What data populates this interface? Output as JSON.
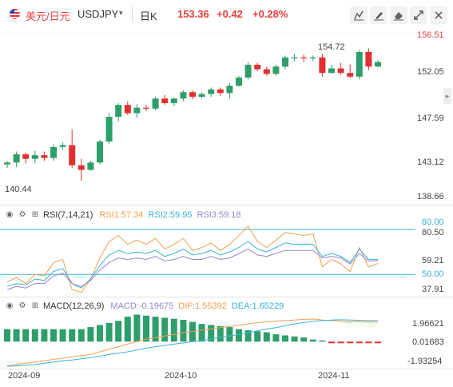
{
  "header": {
    "symbol_cn": "美元/日元",
    "symbol_code": "USDJPY",
    "caret": "▾",
    "period": "日K",
    "price": "153.36",
    "change": "+0.42",
    "change_pct": "+0.28%"
  },
  "toolbar": {
    "icons": [
      "draw-line-icon",
      "brush-icon",
      "erase-icon",
      "fullscreen-icon",
      "close-icon"
    ]
  },
  "main_axis": {
    "ticks": [
      "156.51",
      "152.05",
      "147.59",
      "143.12",
      "138.66"
    ],
    "high_label": "154.72",
    "low_label": "140.44"
  },
  "rsi": {
    "name": "RSI(7,14,21)",
    "rsi1": "RSI1:57.34",
    "rsi2": "RSI2:59.95",
    "rsi3": "RSI3:59.18",
    "ticks": [
      "80.00",
      "80.50",
      "59.21",
      "50.00",
      "37.91"
    ]
  },
  "macd": {
    "name": "MACD(12,26,9)",
    "macd": "MACD:-0.19675",
    "dif": "DIF:1.55392",
    "dea": "DEA:1.65229",
    "ticks": [
      "1.96621",
      "0.01683",
      "-1.93254"
    ]
  },
  "xaxis": [
    "2024-09",
    "2024-10",
    "2024-11"
  ],
  "colors": {
    "up": "#2e9e6b",
    "down": "#e03030",
    "rsi1": "#f0a050",
    "rsi2": "#39b3d6",
    "rsi3": "#9a85c8",
    "dif": "#f0a050",
    "dea": "#39b3d6"
  },
  "chart_data": [
    {
      "type": "candlestick",
      "title": "USDJPY 日K",
      "ylim": [
        138.66,
        156.51
      ],
      "ohlc": [
        [
          142.2,
          142.6,
          141.8,
          142.4
        ],
        [
          142.4,
          143.6,
          141.9,
          143.3
        ],
        [
          143.3,
          143.5,
          142.3,
          142.8
        ],
        [
          142.8,
          143.7,
          142.3,
          143.2
        ],
        [
          143.2,
          143.6,
          142.6,
          142.9
        ],
        [
          142.9,
          144.4,
          142.6,
          144.1
        ],
        [
          144.1,
          144.6,
          143.8,
          144.3
        ],
        [
          144.3,
          146.0,
          141.8,
          142.1
        ],
        [
          142.1,
          142.8,
          140.4,
          141.6
        ],
        [
          141.6,
          142.6,
          141.5,
          142.4
        ],
        [
          142.4,
          144.9,
          142.2,
          144.7
        ],
        [
          144.7,
          147.8,
          144.4,
          147.4
        ],
        [
          147.4,
          148.9,
          146.9,
          148.7
        ],
        [
          148.7,
          149.1,
          147.6,
          147.8
        ],
        [
          147.8,
          148.8,
          147.3,
          148.4
        ],
        [
          148.4,
          148.7,
          148.0,
          148.3
        ],
        [
          148.3,
          149.6,
          148.1,
          149.4
        ],
        [
          149.4,
          149.8,
          148.7,
          148.9
        ],
        [
          148.9,
          149.5,
          148.6,
          149.4
        ],
        [
          149.4,
          150.3,
          149.1,
          150.1
        ],
        [
          150.1,
          150.3,
          149.3,
          149.6
        ],
        [
          149.6,
          150.1,
          149.4,
          149.9
        ],
        [
          149.9,
          150.6,
          149.6,
          150.4
        ],
        [
          150.4,
          150.6,
          149.7,
          150.0
        ],
        [
          150.0,
          151.1,
          149.4,
          150.8
        ],
        [
          150.8,
          151.9,
          150.7,
          151.7
        ],
        [
          151.7,
          153.4,
          151.5,
          153.1
        ],
        [
          153.1,
          153.3,
          152.4,
          152.6
        ],
        [
          152.6,
          152.9,
          151.9,
          152.1
        ],
        [
          152.1,
          153.1,
          151.9,
          152.9
        ],
        [
          152.9,
          154.1,
          152.6,
          153.9
        ],
        [
          153.9,
          154.3,
          153.5,
          153.9
        ],
        [
          153.9,
          154.2,
          153.4,
          153.8
        ],
        [
          153.8,
          154.1,
          153.5,
          153.9
        ],
        [
          153.9,
          154.3,
          151.8,
          152.2
        ],
        [
          152.2,
          153.1,
          152.1,
          152.7
        ],
        [
          152.7,
          153.3,
          152.0,
          152.2
        ],
        [
          152.2,
          153.1,
          151.6,
          151.8
        ],
        [
          151.8,
          154.7,
          151.5,
          154.5
        ],
        [
          154.5,
          154.9,
          152.5,
          152.9
        ],
        [
          152.9,
          153.6,
          152.8,
          153.4
        ]
      ]
    },
    {
      "type": "line",
      "title": "RSI(7,14,21)",
      "ylim": [
        37.91,
        80.5
      ],
      "series": [
        {
          "name": "RSI1",
          "values": [
            45,
            48,
            44,
            50,
            49,
            58,
            60,
            40,
            38,
            47,
            61,
            72,
            76,
            70,
            73,
            70,
            74,
            67,
            70,
            74,
            66,
            68,
            71,
            66,
            70,
            76,
            82,
            72,
            68,
            73,
            78,
            77,
            76,
            77,
            55,
            60,
            57,
            52,
            68,
            55,
            57.34
          ]
        },
        {
          "name": "RSI2",
          "values": [
            42,
            44,
            43,
            47,
            46,
            52,
            54,
            44,
            41,
            47,
            56,
            63,
            66,
            64,
            65,
            64,
            66,
            62,
            64,
            67,
            63,
            64,
            66,
            63,
            65,
            68,
            72,
            67,
            65,
            68,
            71,
            70,
            70,
            70,
            62,
            64,
            62,
            58,
            67,
            60,
            59.95
          ]
        },
        {
          "name": "RSI3",
          "values": [
            40,
            42,
            41,
            44,
            44,
            49,
            51,
            44,
            42,
            46,
            53,
            58,
            61,
            60,
            61,
            60,
            62,
            59,
            60,
            62,
            60,
            60,
            62,
            60,
            61,
            64,
            67,
            63,
            62,
            64,
            66,
            66,
            66,
            66,
            61,
            62,
            61,
            57,
            64,
            59,
            59.18
          ]
        }
      ]
    },
    {
      "type": "bar",
      "title": "MACD(12,26,9)",
      "ylim": [
        -1.93254,
        1.96621
      ],
      "values": [
        0.6,
        0.6,
        0.6,
        0.6,
        0.6,
        0.6,
        0.6,
        0.6,
        0.6,
        0.7,
        0.8,
        0.9,
        1.0,
        1.2,
        1.3,
        1.25,
        1.2,
        1.15,
        1.1,
        1.05,
        0.95,
        0.85,
        0.8,
        0.75,
        0.7,
        0.6,
        0.55,
        0.5,
        0.45,
        0.35,
        0.3,
        0.25,
        0.2,
        0.1,
        0.05,
        -0.05,
        -0.1,
        -0.15,
        -0.1,
        -0.15,
        -0.19675
      ],
      "series": [
        {
          "name": "DIF",
          "values": [
            -1.9,
            -1.8,
            -1.7,
            -1.6,
            -1.5,
            -1.4,
            -1.3,
            -1.2,
            -1.1,
            -1.0,
            -0.8,
            -0.6,
            -0.4,
            -0.2,
            0.0,
            0.2,
            0.3,
            0.45,
            0.55,
            0.7,
            0.8,
            0.9,
            1.0,
            1.1,
            1.2,
            1.3,
            1.4,
            1.5,
            1.55,
            1.6,
            1.65,
            1.7,
            1.75,
            1.78,
            1.7,
            1.65,
            1.6,
            1.55,
            1.58,
            1.55,
            1.55392
          ]
        },
        {
          "name": "DEA",
          "values": [
            -1.95,
            -1.9,
            -1.85,
            -1.8,
            -1.7,
            -1.6,
            -1.5,
            -1.45,
            -1.35,
            -1.25,
            -1.15,
            -1.0,
            -0.9,
            -0.8,
            -0.65,
            -0.5,
            -0.4,
            -0.3,
            -0.2,
            -0.1,
            0.0,
            0.1,
            0.2,
            0.35,
            0.45,
            0.55,
            0.7,
            0.85,
            1.0,
            1.1,
            1.25,
            1.4,
            1.5,
            1.6,
            1.65,
            1.7,
            1.72,
            1.7,
            1.68,
            1.66,
            1.65229
          ]
        }
      ]
    }
  ]
}
